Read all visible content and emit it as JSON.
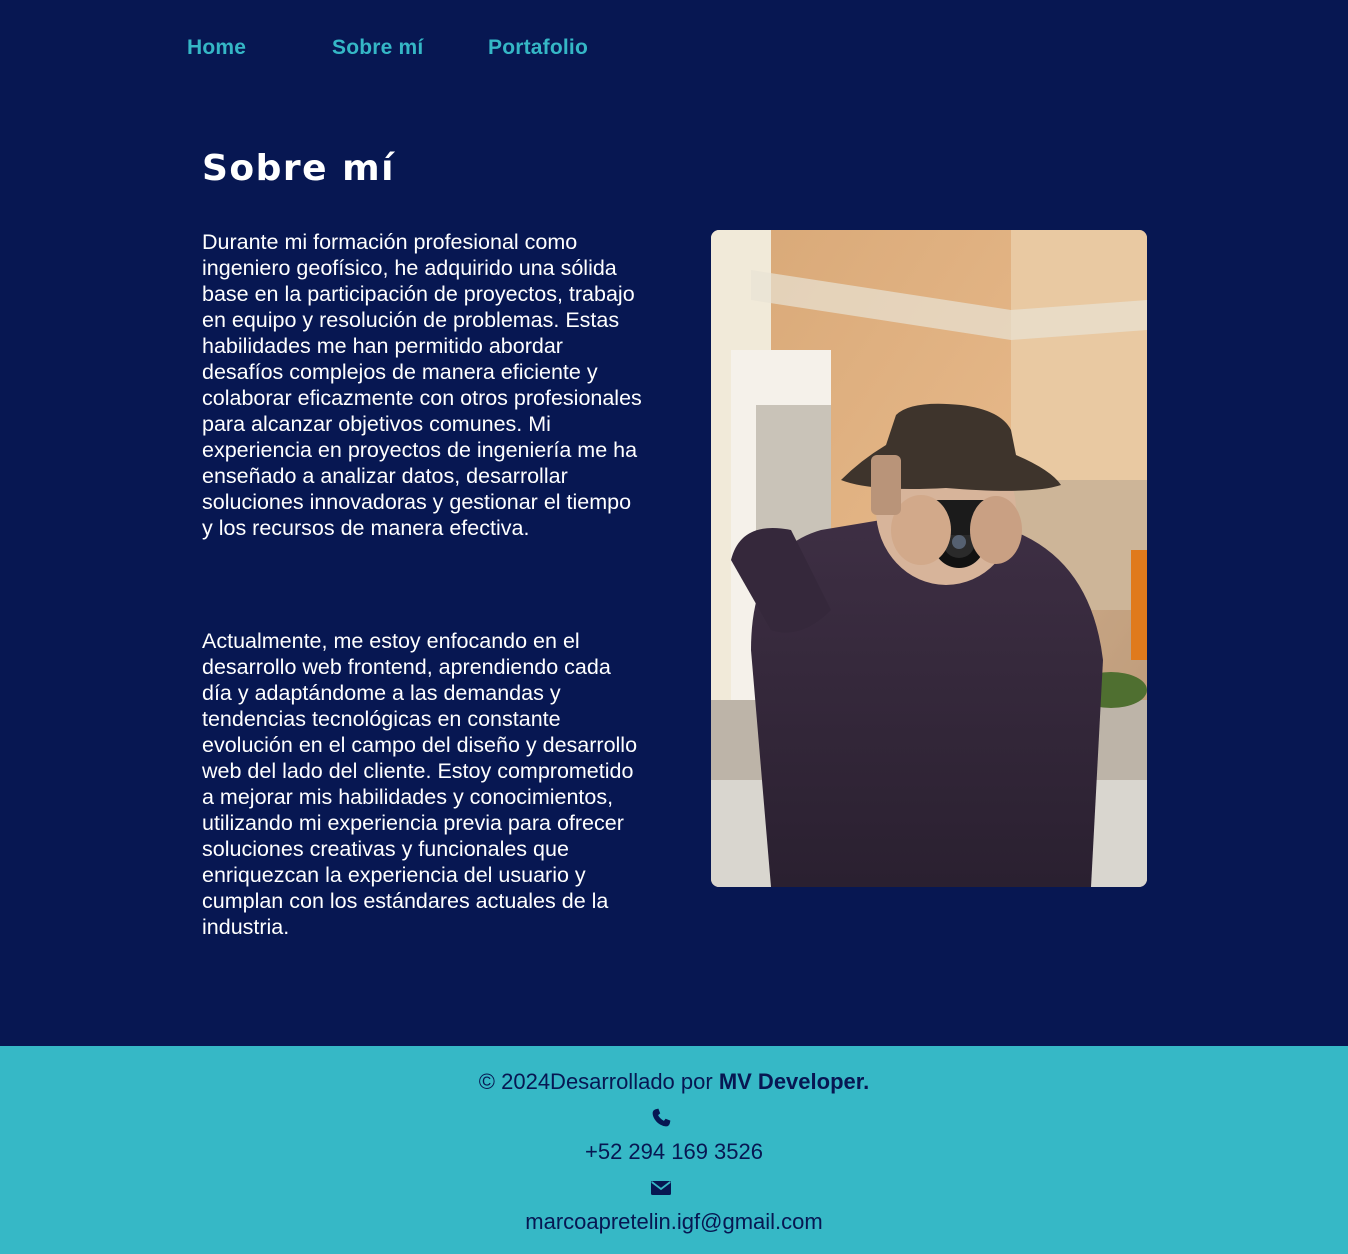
{
  "nav": {
    "items": [
      {
        "label": "Home"
      },
      {
        "label": "Sobre mí"
      },
      {
        "label": "Portafolio"
      }
    ]
  },
  "main": {
    "title": "Sobre mí",
    "paragraphs": [
      "Durante mi formación profesional como ingeniero geofísico, he adquirido una sólida base en la participación de proyectos, trabajo en equipo y resolución de problemas. Estas habilidades me han permitido abordar desafíos complejos de manera eficiente y colaborar eficazmente con otros profesionales para alcanzar objetivos comunes. Mi experiencia en proyectos de ingeniería me ha enseñado a analizar datos, desarrollar soluciones innovadoras y gestionar el tiempo y los recursos de manera efectiva.",
      "Actualmente, me estoy enfocando en el desarrollo web frontend, aprendiendo cada día y adaptándome a las demandas y tendencias tecnológicas en constante evolución en el campo del diseño y desarrollo web del lado del cliente. Estoy comprometido a mejorar mis habilidades y conocimientos, utilizando mi experiencia previa para ofrecer soluciones creativas y funcionales que enriquezcan la experiencia del usuario y cumplan con los estándares actuales de la industria."
    ]
  },
  "footer": {
    "credit_prefix": "© 2024Desarrollado por ",
    "credit_name": "MV Developer.",
    "phone": "+52 294 169 3526",
    "email": "marcoapretelin.igf@gmail.com",
    "phone_icon": "phone-icon",
    "email_icon": "envelope-icon"
  },
  "colors": {
    "background": "#071752",
    "accent": "#35b7c6",
    "footer_bg": "#36b8c6",
    "text": "#ffffff"
  }
}
